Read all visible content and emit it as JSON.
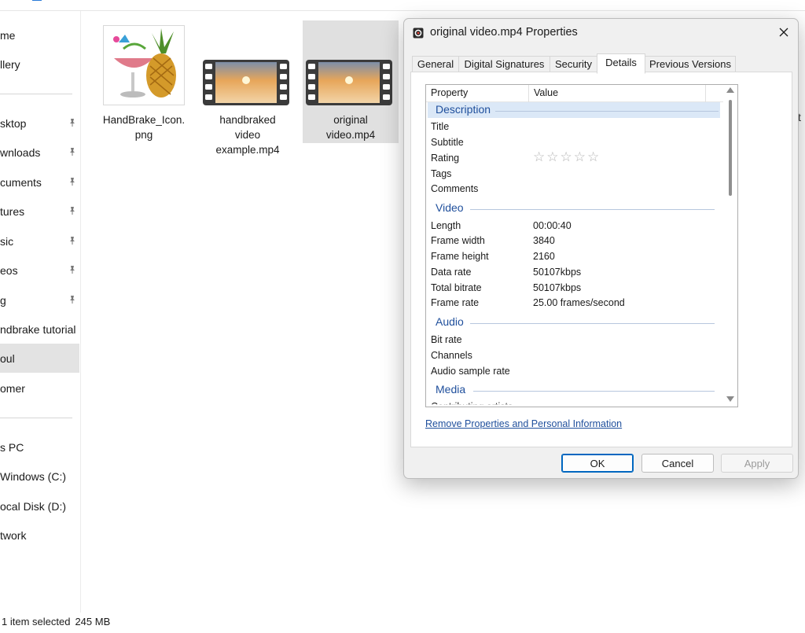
{
  "nav": {
    "items": [
      {
        "label": "me",
        "pinned": false,
        "selected": false
      },
      {
        "label": "llery",
        "pinned": false,
        "selected": false
      },
      {
        "label": "sktop",
        "pinned": true,
        "selected": false
      },
      {
        "label": "wnloads",
        "pinned": true,
        "selected": false
      },
      {
        "label": "cuments",
        "pinned": true,
        "selected": false
      },
      {
        "label": "tures",
        "pinned": true,
        "selected": false
      },
      {
        "label": "sic",
        "pinned": true,
        "selected": false
      },
      {
        "label": "eos",
        "pinned": true,
        "selected": false
      },
      {
        "label": "g",
        "pinned": true,
        "selected": false
      },
      {
        "label": "ndbrake tutorial",
        "pinned": false,
        "selected": false
      },
      {
        "label": "oul",
        "pinned": false,
        "selected": true
      },
      {
        "label": "omer",
        "pinned": false,
        "selected": false
      },
      {
        "label": "s PC",
        "pinned": false,
        "selected": false
      },
      {
        "label": "Windows (C:)",
        "pinned": false,
        "selected": false
      },
      {
        "label": "ocal Disk (D:)",
        "pinned": false,
        "selected": false
      },
      {
        "label": "twork",
        "pinned": false,
        "selected": false
      }
    ]
  },
  "files": [
    {
      "name_line1": "HandBrake_Icon.",
      "name_line2": "png",
      "name_line3": ""
    },
    {
      "name_line1": "handbraked",
      "name_line2": "video",
      "name_line3": "example.mp4"
    },
    {
      "name_line1": "original",
      "name_line2": "video.mp4",
      "name_line3": ""
    }
  ],
  "status": {
    "selection": "1 item selected",
    "size": "245 MB"
  },
  "right_fragment": "t",
  "dialog": {
    "title": "original video.mp4 Properties",
    "tabs": [
      "General",
      "Digital Signatures",
      "Security",
      "Details",
      "Previous Versions"
    ],
    "active_tab": "Details",
    "columns": {
      "property": "Property",
      "value": "Value"
    },
    "groups": {
      "description": {
        "label": "Description",
        "rows": [
          {
            "name": "Title",
            "value": ""
          },
          {
            "name": "Subtitle",
            "value": ""
          },
          {
            "name": "Rating",
            "value": ""
          },
          {
            "name": "Tags",
            "value": ""
          },
          {
            "name": "Comments",
            "value": ""
          }
        ]
      },
      "video": {
        "label": "Video",
        "rows": [
          {
            "name": "Length",
            "value": "00:00:40"
          },
          {
            "name": "Frame width",
            "value": "3840"
          },
          {
            "name": "Frame height",
            "value": "2160"
          },
          {
            "name": "Data rate",
            "value": "50107kbps"
          },
          {
            "name": "Total bitrate",
            "value": "50107kbps"
          },
          {
            "name": "Frame rate",
            "value": "25.00 frames/second"
          }
        ]
      },
      "audio": {
        "label": "Audio",
        "rows": [
          {
            "name": "Bit rate",
            "value": ""
          },
          {
            "name": "Channels",
            "value": ""
          },
          {
            "name": "Audio sample rate",
            "value": ""
          }
        ]
      },
      "media": {
        "label": "Media",
        "rows": [
          {
            "name": "Contributing artists",
            "value": ""
          }
        ]
      }
    },
    "rating_stars": "☆☆☆☆☆",
    "remove_link": "Remove Properties and Personal Information",
    "buttons": {
      "ok": "OK",
      "cancel": "Cancel",
      "apply": "Apply"
    }
  },
  "colors": {
    "accent": "#0067c0",
    "group_header": "#1f4f9c",
    "selection": "#e0e0e0"
  }
}
